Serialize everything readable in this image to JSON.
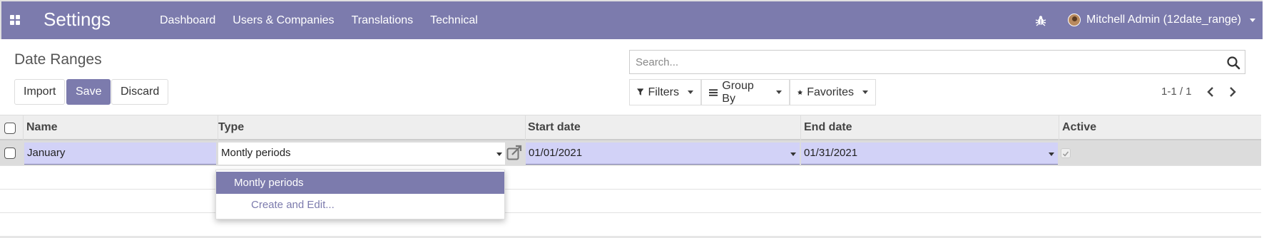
{
  "navbar": {
    "app_title": "Settings",
    "menu": [
      "Dashboard",
      "Users & Companies",
      "Translations",
      "Technical"
    ],
    "user": "Mitchell Admin (12date_range)",
    "color": "#7c7bad"
  },
  "control_panel": {
    "breadcrumb": "Date Ranges",
    "buttons": {
      "import": "Import",
      "save": "Save",
      "discard": "Discard"
    },
    "search_placeholder": "Search...",
    "filters": "Filters",
    "group_by": "Group By",
    "favorites": "Favorites",
    "pager": "1-1 / 1"
  },
  "table": {
    "columns": [
      "Name",
      "Type",
      "Start date",
      "End date",
      "Active"
    ],
    "row": {
      "name": "January",
      "type": "Montly periods",
      "start_date": "01/01/2021",
      "end_date": "01/31/2021",
      "active": true
    }
  },
  "dropdown": {
    "options": [
      "Montly periods"
    ],
    "create_edit": "Create and Edit..."
  },
  "icons": [
    "apps-icon",
    "bug-icon",
    "avatar",
    "search-icon",
    "filter-icon",
    "group-by-icon",
    "star-icon",
    "chevron-left-icon",
    "chevron-right-icon",
    "external-link-icon"
  ]
}
